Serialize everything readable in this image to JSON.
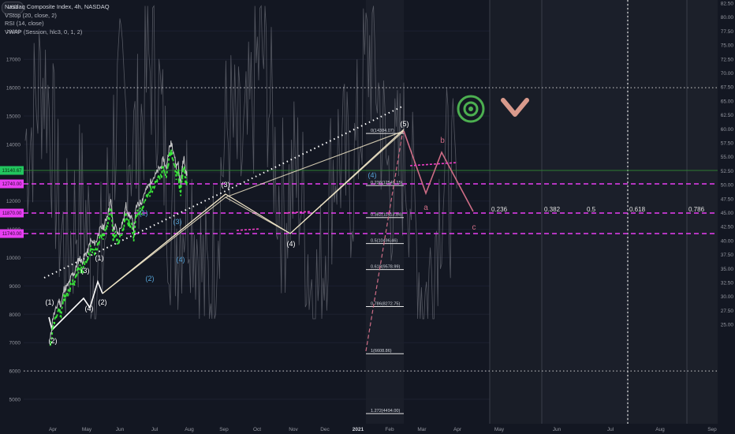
{
  "legend": {
    "title": "Nasdaq Composite Index, 4h, NASDAQ",
    "lines": [
      "VStop (20, close, 2)",
      "RSI (14, close)",
      "VWAP (Session, hlc3, 0, 1, 2)"
    ]
  },
  "currency": "USD",
  "colors": {
    "background": "#131722",
    "price": "#d6d6d6",
    "rsi": "#6b6e77",
    "fib": "#e83ef2",
    "projection": "#cf6d86",
    "wave_white": "#ffffff",
    "wave_blue": "#55a2d6",
    "vstop_green": "#39e639",
    "vstop_pink": "#f23ec8",
    "eye_icon": "#4caf50",
    "chevron_icon": "#d99a8c"
  },
  "chart_data": {
    "type": "line",
    "title": "Nasdaq Composite Index, 4h, NASDAQ",
    "xlabel": "",
    "ylabel": "",
    "y_ticks_left": [
      5000,
      6000,
      7000,
      8000,
      9000,
      10000,
      11000,
      12000,
      13000,
      14000,
      15000,
      16000,
      17000,
      18000
    ],
    "y_ticks_right": [
      "82.50",
      "80.00",
      "77.50",
      "75.00",
      "72.50",
      "70.00",
      "67.50",
      "65.00",
      "62.50",
      "60.00",
      "57.50",
      "55.00",
      "52.50",
      "50.00",
      "47.50",
      "45.00",
      "42.50",
      "40.00",
      "37.50",
      "35.00",
      "32.50",
      "30.00",
      "27.50",
      "25.00"
    ],
    "x_ticks": [
      "Apr",
      "May",
      "Jun",
      "Jul",
      "Aug",
      "Sep",
      "Oct",
      "Nov",
      "Dec",
      "2021",
      "Feb",
      "Mar",
      "Apr",
      "May",
      "Jun",
      "Jul",
      "Aug",
      "Sep"
    ],
    "price_labels": {
      "current": "13140.67",
      "levels": [
        "12740.00",
        "11870.00",
        "11740.00"
      ]
    },
    "series": [
      {
        "name": "",
        "x": [
          "2020-03-23",
          "2020-03-30",
          "2020-04-07",
          "2020-04-15",
          "2020-04-21",
          "2020-04-29",
          "2020-05-05",
          "2020-05-13",
          "2020-05-20",
          "2020-05-27",
          "2020-06-03",
          "2020-06-10",
          "2020-06-16",
          "2020-06-24",
          "2020-07-01",
          "2020-07-09",
          "2020-07-16",
          "2020-07-24",
          "2020-07-31",
          "2020-08-07",
          "2020-08-14",
          "2020-08-21",
          "2020-08-27",
          "2020-09-02",
          "2020-09-08",
          "2020-09-14",
          "2020-09-21",
          "2020-09-29",
          "2020-10-06",
          "2020-10-12",
          "2020-10-20",
          "2020-10-27",
          "2020-11-02",
          "2020-11-09",
          "2020-11-17",
          "2020-11-24",
          "2020-12-01",
          "2020-12-08",
          "2020-12-15",
          "2020-12-22",
          "2020-12-30",
          "2021-01-07",
          "2021-01-14",
          "2021-01-21",
          "2021-01-28",
          "2021-02-04",
          "2021-02-09",
          "2021-02-12",
          "2021-02-18",
          "2021-02-24",
          "2021-03-01",
          "2021-03-04",
          "2021-03-08",
          "2021-03-12",
          "2021-03-17",
          "2021-03-22",
          "2021-03-25"
        ],
        "values": [
          7100,
          7900,
          8150,
          8500,
          8300,
          8900,
          8950,
          9100,
          9400,
          9450,
          9800,
          10000,
          9850,
          10100,
          10200,
          10600,
          10500,
          10550,
          10900,
          11050,
          11100,
          11400,
          11700,
          12050,
          11000,
          11100,
          10800,
          11150,
          11350,
          11850,
          11500,
          11400,
          11000,
          11800,
          11900,
          12000,
          12300,
          12450,
          12600,
          12800,
          12900,
          13100,
          13200,
          13500,
          13100,
          13800,
          14000,
          14050,
          13700,
          13200,
          13400,
          12900,
          12600,
          13200,
          13500,
          13000,
          12900
        ]
      }
    ],
    "fib_retracement": [
      {
        "label": "0(14384.07)",
        "value": 14384.07
      },
      {
        "label": "0.236(12549.15)",
        "value": 12549.15
      },
      {
        "label": "0.382(11413.84)",
        "value": 11413.84
      },
      {
        "label": "0.5(10496.46)",
        "value": 10496.46
      },
      {
        "label": "0.618(9578.99)",
        "value": 9578.99
      },
      {
        "label": "0.786(8272.75)",
        "value": 8272.75
      },
      {
        "label": "1(6608.86)",
        "value": 6608.86
      },
      {
        "label": "1.272(4494.00)",
        "value": 4494.0
      }
    ],
    "time_fib_labels": [
      "0.236",
      "0.382",
      "0.5",
      "0.618",
      "0.786"
    ],
    "wave_labels": [
      "(1)",
      "(2)",
      "(3)",
      "(4)",
      "(1)",
      "(2)",
      "(3)",
      "(4)",
      "(5)",
      "(4)",
      "(5)",
      "a",
      "b",
      "c"
    ],
    "horizontal_levels": {
      "dotted_upper": 16000,
      "dotted_lower": 6000
    }
  }
}
